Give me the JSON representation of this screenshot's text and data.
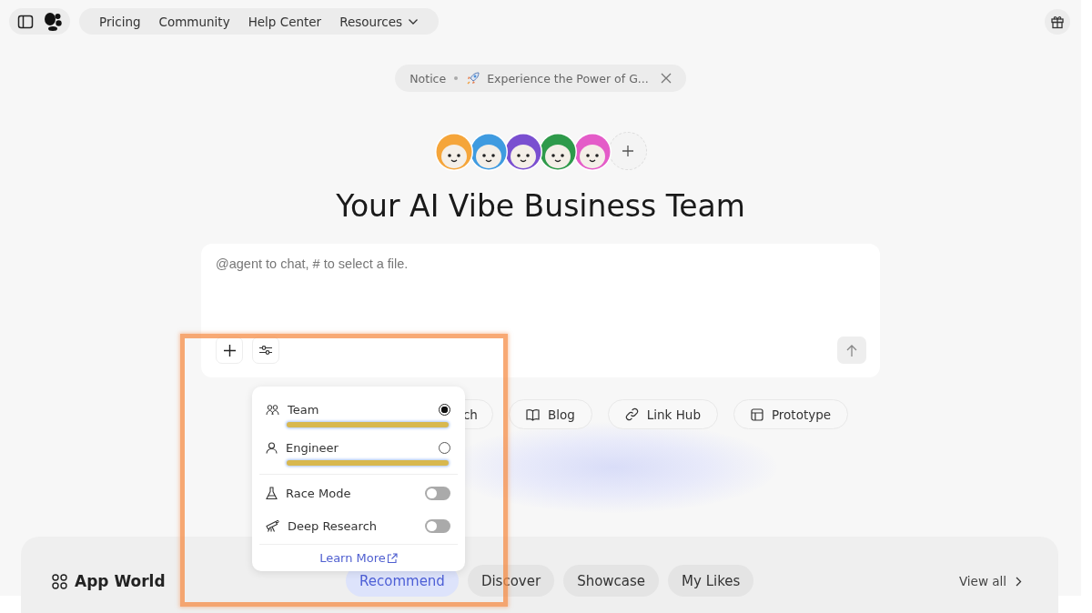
{
  "nav": {
    "links": [
      {
        "label": "Pricing",
        "kind": "link"
      },
      {
        "label": "Community",
        "kind": "link"
      },
      {
        "label": "Help Center",
        "kind": "link"
      },
      {
        "label": "Resources",
        "kind": "menu"
      }
    ]
  },
  "notice": {
    "label": "Notice",
    "text": "Experience the Power of G..."
  },
  "avatars": [
    {
      "color": "#f5a53a"
    },
    {
      "color": "#3f9be0"
    },
    {
      "color": "#7a4fd0"
    },
    {
      "color": "#2e9a4a"
    },
    {
      "color": "#e45cc8"
    }
  ],
  "heading": "Your AI Vibe Business Team",
  "composer": {
    "placeholder": "@agent to chat, # to select a file."
  },
  "chips": [
    {
      "label": "ch",
      "kind": "partial"
    },
    {
      "label": "Blog",
      "kind": "book"
    },
    {
      "label": "Link Hub",
      "kind": "link"
    },
    {
      "label": "Prototype",
      "kind": "layout"
    }
  ],
  "settings_menu": {
    "modes": [
      {
        "label": "Team",
        "kind": "team",
        "selected": true
      },
      {
        "label": "Engineer",
        "kind": "person",
        "selected": false
      }
    ],
    "toggles": [
      {
        "label": "Race Mode",
        "kind": "flask",
        "on": false
      },
      {
        "label": "Deep Research",
        "kind": "telescope",
        "on": false
      }
    ],
    "link": "Learn More"
  },
  "app_world": {
    "title": "App World",
    "tabs": [
      {
        "label": "Recommend",
        "selected": true
      },
      {
        "label": "Discover",
        "selected": false
      },
      {
        "label": "Showcase",
        "selected": false
      },
      {
        "label": "My Likes",
        "selected": false
      }
    ],
    "view_all": "View all"
  }
}
